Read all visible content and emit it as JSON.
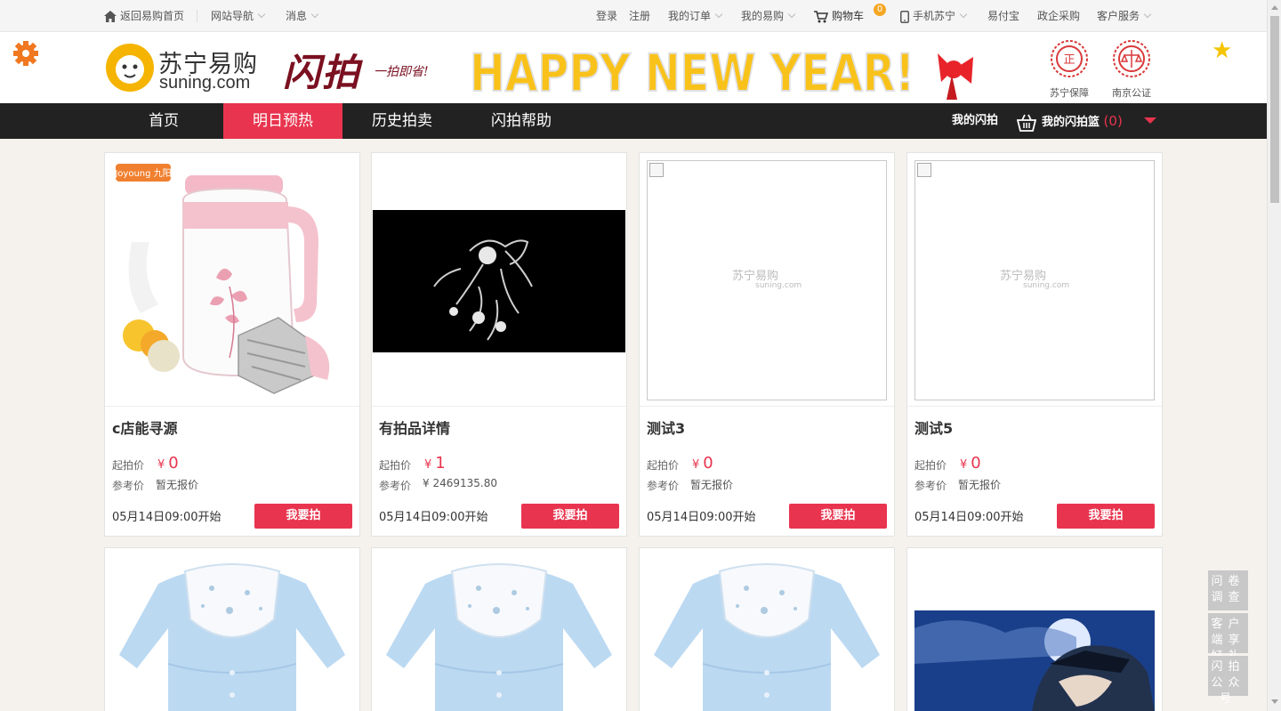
{
  "topbar": {
    "home": "返回易购首页",
    "site_nav": "网站导航",
    "messages": "消息",
    "login": "登录",
    "register": "注册",
    "my_orders": "我的订单",
    "my_yigou": "我的易购",
    "cart": "购物车",
    "cart_count": "0",
    "mobile": "手机苏宁",
    "yifubao": "易付宝",
    "gov_purchase": "政企采购",
    "customer_service": "客户服务"
  },
  "header": {
    "logo_cn": "苏宁易购",
    "logo_en": "suning.com",
    "brand_title": "闪拍",
    "brand_slogan": "一拍即省!",
    "banner_text": "HAPPY NEW YEAR!",
    "badge1": "苏宁保障",
    "badge2": "南京公证"
  },
  "nav": {
    "items": [
      "首页",
      "明日预热",
      "历史拍卖",
      "闪拍帮助"
    ],
    "active": "明日预热",
    "my_flash": "我的闪拍",
    "my_basket": "我的闪拍篮",
    "basket_count": "(0)"
  },
  "labels": {
    "start_price": "起拍价",
    "ref_price": "参考价",
    "bid_button": "我要拍",
    "currency": "¥",
    "placeholder_logo": "苏宁易购",
    "placeholder_logo_en": "suning.com"
  },
  "products": [
    {
      "title": "c店能寻源",
      "start_price": "0",
      "ref_price": "暂无报价",
      "start_time": "05月14日09:00开始",
      "image": "soymilk-maker"
    },
    {
      "title": "有拍品详情",
      "start_price": "1",
      "ref_price": "¥ 2469135.80",
      "start_time": "05月14日09:00开始",
      "image": "dark-figure"
    },
    {
      "title": "测试3",
      "start_price": "0",
      "ref_price": "暂无报价",
      "start_time": "05月14日09:00开始",
      "image": "placeholder"
    },
    {
      "title": "测试5",
      "start_price": "0",
      "ref_price": "暂无报价",
      "start_time": "05月14日09:00开始",
      "image": "placeholder"
    },
    {
      "image": "baby-romper"
    },
    {
      "image": "baby-romper"
    },
    {
      "image": "baby-romper"
    },
    {
      "image": "anime-night"
    }
  ],
  "side_tabs": [
    "问卷调查",
    "客户端享好礼",
    "闪拍公众号"
  ],
  "colors": {
    "accent": "#e8344e",
    "nav_bg": "#222222",
    "page_bg": "#f5f1ec",
    "star": "#f5c400"
  }
}
